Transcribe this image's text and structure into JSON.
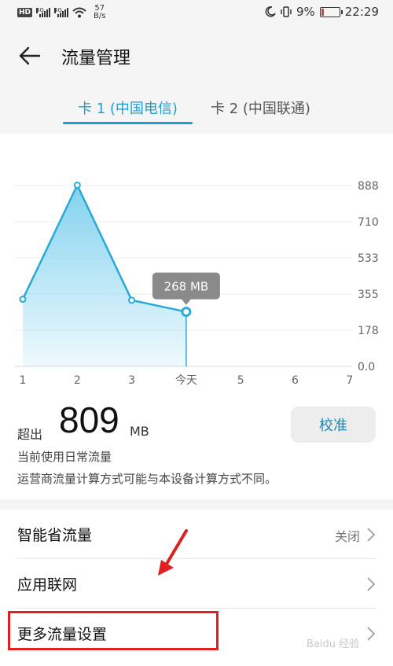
{
  "status_bar": {
    "hd": "HD",
    "net1": "4G",
    "net2": "4G",
    "speed_value": "57",
    "speed_unit": "B/s",
    "battery_text": "9%",
    "time": "22:29"
  },
  "header": {
    "title": "流量管理"
  },
  "tabs": [
    {
      "label": "卡 1 (中国电信)",
      "active": true
    },
    {
      "label": "卡 2 (中国联通)",
      "active": false
    }
  ],
  "chart_data": {
    "type": "area",
    "x": [
      "1",
      "2",
      "3",
      "今天",
      "5",
      "6",
      "7"
    ],
    "values": [
      330,
      890,
      325,
      268
    ],
    "y_ticks": [
      "888",
      "710",
      "533",
      "355",
      "178",
      "0.0"
    ],
    "ylim": [
      0,
      888
    ],
    "tooltip": "268 MB",
    "grid": true,
    "colors": {
      "line": "#29a9d8",
      "fill": "#7cd0ee"
    }
  },
  "summary": {
    "excess_label": "超出",
    "excess_value": "809",
    "excess_unit": "MB",
    "calibrate_button": "校准",
    "desc1": "当前使用日常流量",
    "desc2": "运营商流量计算方式可能与本设备计算方式不同。"
  },
  "settings": [
    {
      "label": "智能省流量",
      "value": "关闭"
    },
    {
      "label": "应用联网",
      "value": ""
    },
    {
      "label": "更多流量设置",
      "value": ""
    }
  ],
  "watermark": "Baidu 经验",
  "colors": {
    "accent": "#1e9ed0",
    "annotation": "#e02020"
  }
}
